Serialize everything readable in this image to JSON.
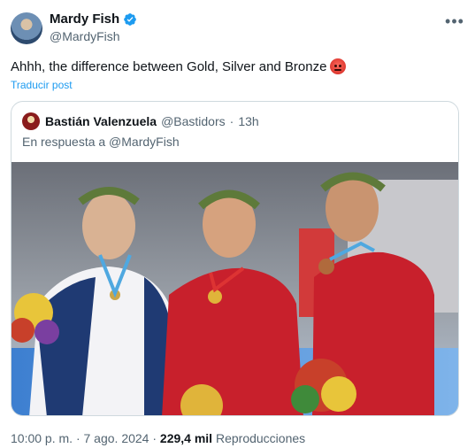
{
  "author": {
    "name": "Mardy Fish",
    "handle": "@MardyFish",
    "verified_icon": "verified-badge-icon",
    "more_icon": "more-horizontal-icon"
  },
  "tweet": {
    "text": "Ahhh, the difference between Gold, Silver and Bronze",
    "emoji": "angry-face-emoji",
    "translate_label": "Traducir post"
  },
  "quoted": {
    "name": "Bastián Valenzuela",
    "handle": "@Bastidors",
    "separator": "·",
    "time": "13h",
    "reply_context": "En respuesta a @MardyFish",
    "image": "photo of three tennis players with laurel wreaths holding olympic medals on a podium"
  },
  "meta": {
    "time": "10:00 p. m.",
    "separator": "·",
    "date": "7 ago. 2024",
    "views_count": "229,4 mil",
    "views_label": "Reproducciones"
  },
  "colors": {
    "link": "#1d9bf0",
    "secondary": "#536471",
    "border": "#cfd9de"
  }
}
